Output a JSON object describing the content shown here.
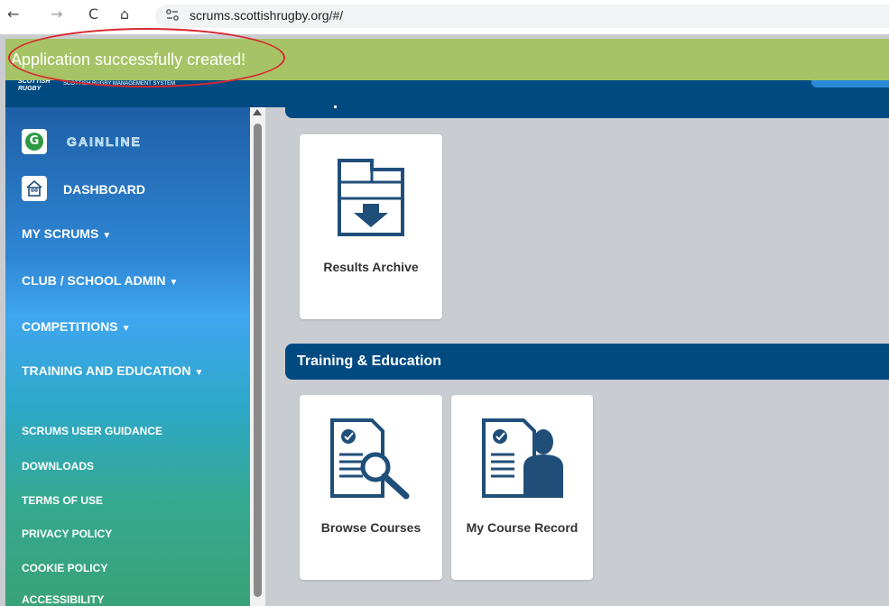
{
  "browser": {
    "url": "scrums.scottishrugby.org/#/",
    "back_icon": "←",
    "forward_icon": "→",
    "reload_icon": "C",
    "home_icon": "⌂",
    "site_info_icon": "⚬"
  },
  "toast": {
    "message": "Application successfully created!",
    "color": "#a6c466",
    "annotation_color": "#d7282f"
  },
  "header": {
    "logo_text": "SCOTTISH RUGBY",
    "subtitle": "SCOTTISH RUGBY MANAGEMENT SYSTEM"
  },
  "sidebar": {
    "gainline_badge": "G",
    "gainline_label": "GAINLINE",
    "dashboard_label": "DASHBOARD",
    "menus": [
      {
        "label": "MY SCRUMS",
        "caret": "▼"
      },
      {
        "label": "CLUB / SCHOOL ADMIN",
        "caret": "▼"
      },
      {
        "label": "COMPETITIONS",
        "caret": "▼"
      },
      {
        "label": "TRAINING AND EDUCATION",
        "caret": "▼"
      }
    ],
    "links": [
      "SCRUMS USER GUIDANCE",
      "DOWNLOADS",
      "TERMS OF USE",
      "PRIVACY POLICY",
      "COOKIE POLICY",
      "ACCESSIBILITY"
    ]
  },
  "content": {
    "section_training_title": "Training & Education",
    "tiles": {
      "results_archive": "Results Archive",
      "browse_courses": "Browse Courses",
      "my_course_record": "My Course Record"
    }
  },
  "colors": {
    "brand_navy": "#004a82",
    "icon_navy": "#1f4e79"
  }
}
